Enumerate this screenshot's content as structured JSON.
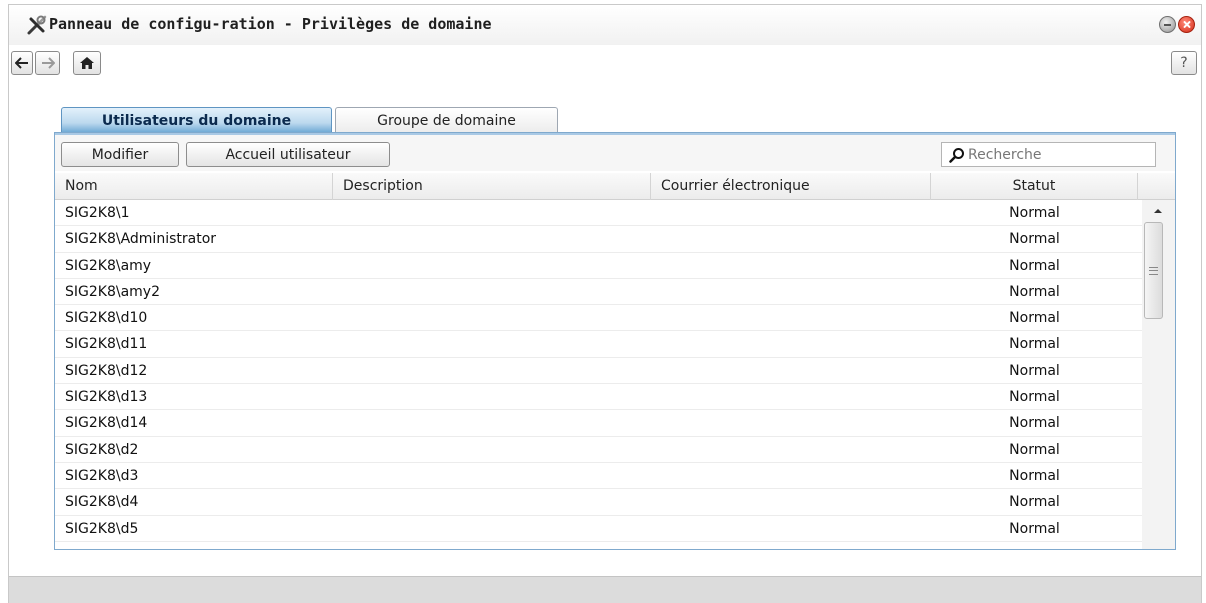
{
  "window": {
    "title": "Panneau de configu-ration - Privilèges de domaine"
  },
  "toolbar": {
    "back_icon": "arrow-left-icon",
    "forward_icon": "arrow-right-icon",
    "home_icon": "home-icon",
    "help_label": "?"
  },
  "tabs": [
    {
      "label": "Utilisateurs du domaine",
      "active": true
    },
    {
      "label": "Groupe de domaine",
      "active": false
    }
  ],
  "actions": {
    "modifier_label": "Modifier",
    "accueil_label": "Accueil utilisateur"
  },
  "search": {
    "placeholder": "Recherche",
    "value": ""
  },
  "columns": {
    "nom": "Nom",
    "description": "Description",
    "courrier": "Courrier électronique",
    "statut": "Statut"
  },
  "rows": [
    {
      "nom": "SIG2K8\\1",
      "statut": "Normal"
    },
    {
      "nom": "SIG2K8\\Administrator",
      "statut": "Normal"
    },
    {
      "nom": "SIG2K8\\amy",
      "statut": "Normal"
    },
    {
      "nom": "SIG2K8\\amy2",
      "statut": "Normal"
    },
    {
      "nom": "SIG2K8\\d10",
      "statut": "Normal"
    },
    {
      "nom": "SIG2K8\\d11",
      "statut": "Normal"
    },
    {
      "nom": "SIG2K8\\d12",
      "statut": "Normal"
    },
    {
      "nom": "SIG2K8\\d13",
      "statut": "Normal"
    },
    {
      "nom": "SIG2K8\\d14",
      "statut": "Normal"
    },
    {
      "nom": "SIG2K8\\d2",
      "statut": "Normal"
    },
    {
      "nom": "SIG2K8\\d3",
      "statut": "Normal"
    },
    {
      "nom": "SIG2K8\\d4",
      "statut": "Normal"
    },
    {
      "nom": "SIG2K8\\d5",
      "statut": "Normal"
    }
  ],
  "colors": {
    "accent": "#6aa7d3",
    "close": "#d42c17"
  }
}
